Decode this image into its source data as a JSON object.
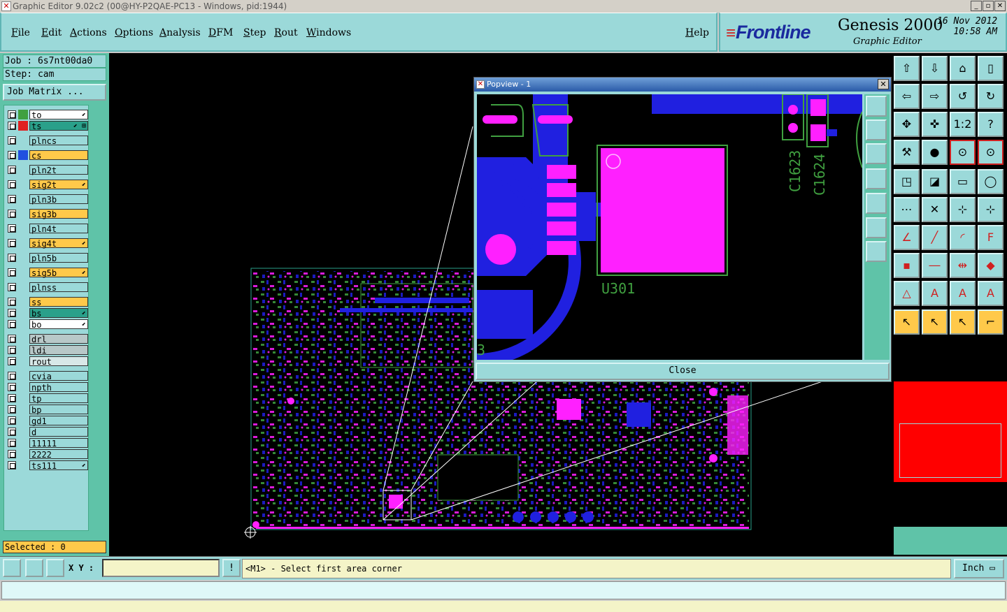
{
  "window": {
    "title": "Graphic Editor 9.02c2 (00@HY-P2QAE-PC13 - Windows, pid:1944)"
  },
  "menu": {
    "items": [
      "File",
      "Edit",
      "Actions",
      "Options",
      "Analysis",
      "DFM",
      "Step",
      "Rout",
      "Windows"
    ],
    "help": "Help"
  },
  "brand": {
    "logo": "Frontline",
    "product": "Genesis 2000",
    "subtitle": "Graphic Editor",
    "date": "16 Nov 2012",
    "time": "10:58 AM"
  },
  "job": {
    "job_line": "Job : 6s7nt00da0",
    "step_line": "Step: cam",
    "matrix_button": "Job Matrix ..."
  },
  "layers": [
    {
      "name": "to",
      "color": "#ffffff",
      "swatch": "#40a040",
      "flag": "⬋"
    },
    {
      "name": "ts",
      "color": "#2aa08a",
      "swatch": "#e02020",
      "flag": "⬋ ⊞"
    },
    {
      "name": "plncs",
      "color": "#9bd9d9",
      "swatch": "",
      "flag": ""
    },
    {
      "name": "cs",
      "color": "#ffc94a",
      "swatch": "#2050e0",
      "flag": ""
    },
    {
      "name": "pln2t",
      "color": "#9bd9d9",
      "swatch": "",
      "flag": ""
    },
    {
      "name": "sig2t",
      "color": "#ffc94a",
      "swatch": "",
      "flag": "⬋"
    },
    {
      "name": "pln3b",
      "color": "#9bd9d9",
      "swatch": "",
      "flag": ""
    },
    {
      "name": "sig3b",
      "color": "#ffc94a",
      "swatch": "",
      "flag": ""
    },
    {
      "name": "pln4t",
      "color": "#9bd9d9",
      "swatch": "",
      "flag": ""
    },
    {
      "name": "sig4t",
      "color": "#ffc94a",
      "swatch": "",
      "flag": "⬋"
    },
    {
      "name": "pln5b",
      "color": "#9bd9d9",
      "swatch": "",
      "flag": ""
    },
    {
      "name": "sig5b",
      "color": "#ffc94a",
      "swatch": "",
      "flag": "⬋"
    },
    {
      "name": "plnss",
      "color": "#9bd9d9",
      "swatch": "",
      "flag": ""
    },
    {
      "name": "ss",
      "color": "#ffc94a",
      "swatch": "",
      "flag": ""
    },
    {
      "name": "bs",
      "color": "#2aa08a",
      "swatch": "",
      "flag": "⬋"
    },
    {
      "name": "bo",
      "color": "#ffffff",
      "swatch": "",
      "flag": "⬋"
    },
    {
      "name": "drl",
      "color": "#b8c8c8",
      "swatch": "",
      "flag": ""
    },
    {
      "name": "ldi",
      "color": "#b8c8c8",
      "swatch": "",
      "flag": ""
    },
    {
      "name": "rout",
      "color": "#d8e8e8",
      "swatch": "",
      "flag": ""
    },
    {
      "name": "cvia",
      "color": "#9bd9d9",
      "swatch": "",
      "flag": ""
    },
    {
      "name": "npth",
      "color": "#9bd9d9",
      "swatch": "",
      "flag": ""
    },
    {
      "name": "tp",
      "color": "#9bd9d9",
      "swatch": "",
      "flag": ""
    },
    {
      "name": "bp",
      "color": "#9bd9d9",
      "swatch": "",
      "flag": ""
    },
    {
      "name": "gd1",
      "color": "#9bd9d9",
      "swatch": "",
      "flag": ""
    },
    {
      "name": "d",
      "color": "#9bd9d9",
      "swatch": "",
      "flag": ""
    },
    {
      "name": "11111",
      "color": "#9bd9d9",
      "swatch": "",
      "flag": ""
    },
    {
      "name": "2222",
      "color": "#9bd9d9",
      "swatch": "",
      "flag": ""
    },
    {
      "name": "ts111",
      "color": "#9bd9d9",
      "swatch": "",
      "flag": "⬋"
    }
  ],
  "selected": "Selected : 0",
  "popview": {
    "title": "Popview - 1",
    "close": "Close",
    "labels": {
      "component": "U301",
      "cap1": "C1623",
      "cap2": "C1624",
      "edge": "3"
    }
  },
  "status": {
    "xy_label": "X Y :",
    "xy_value": "",
    "message": "<M1> - Select first area corner",
    "units": "Inch"
  },
  "colors": {
    "board_outline": "#2aa08a",
    "copper": "#2020e0",
    "pad": "#ff20ff",
    "silk": "#40a040",
    "background": "#000000"
  }
}
